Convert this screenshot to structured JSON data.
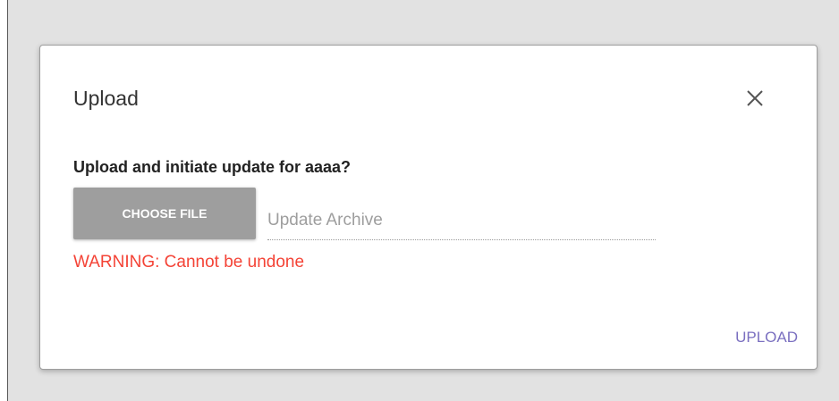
{
  "dialog": {
    "title": "Upload",
    "question": "Upload and initiate update for aaaa?",
    "choose_file_label": "CHOOSE FILE",
    "file_placeholder": "Update Archive",
    "file_value": "",
    "warning": "WARNING: Cannot be undone",
    "upload_label": "UPLOAD",
    "close_icon": "close-icon"
  },
  "colors": {
    "warning": "#f44336",
    "accent": "#7a6fc0",
    "choose_button": "#9e9e9e",
    "backdrop": "#e2e2e2"
  }
}
